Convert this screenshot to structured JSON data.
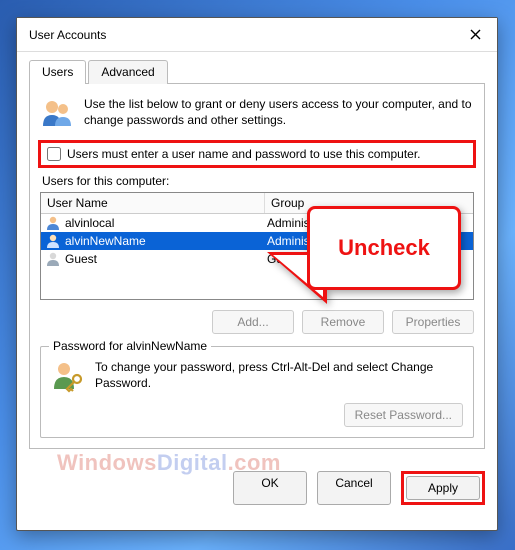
{
  "window": {
    "title": "User Accounts"
  },
  "tabs": {
    "users": "Users",
    "advanced": "Advanced"
  },
  "intro": "Use the list below to grant or deny users access to your computer, and to change passwords and other settings.",
  "checkbox": {
    "label": "Users must enter a user name and password to use this computer.",
    "checked": false
  },
  "list": {
    "label": "Users for this computer:",
    "columns": {
      "name": "User Name",
      "group": "Group"
    },
    "rows": [
      {
        "name": "alvinlocal",
        "group": "Administrators",
        "selected": false
      },
      {
        "name": "alvinNewName",
        "group": "Administrators",
        "selected": true
      },
      {
        "name": "Guest",
        "group": "Guests",
        "selected": false
      }
    ]
  },
  "buttons": {
    "add": "Add...",
    "remove": "Remove",
    "properties": "Properties",
    "ok": "OK",
    "cancel": "Cancel",
    "apply": "Apply",
    "reset_pw": "Reset Password..."
  },
  "password_group": {
    "legend": "Password for alvinNewName",
    "text": "To change your password, press Ctrl-Alt-Del and select Change Password."
  },
  "callout": {
    "text": "Uncheck"
  },
  "watermark": {
    "a": "Windows",
    "b": "Digital",
    "c": ".com"
  }
}
